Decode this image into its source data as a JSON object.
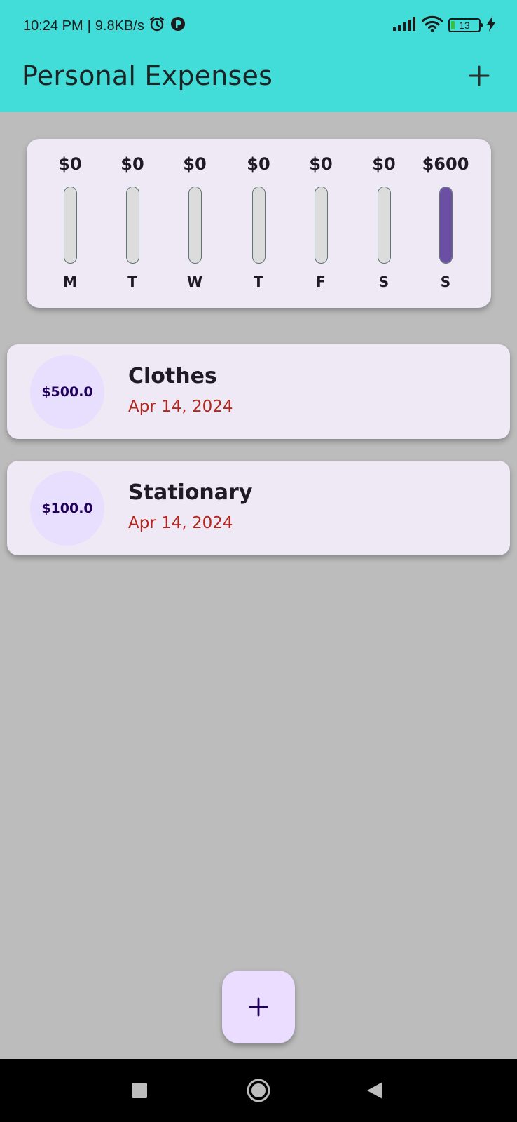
{
  "status_bar": {
    "time": "10:24 PM",
    "separator": "|",
    "net_speed": "9.8KB/s",
    "battery_level": "13",
    "icons": [
      "alarm-icon",
      "app-notification-icon",
      "signal-icon",
      "wifi-icon",
      "battery-icon",
      "charging-icon"
    ]
  },
  "app_bar": {
    "title": "Personal Expenses",
    "action_icon": "plus-icon"
  },
  "chart": {
    "bars": [
      {
        "day": "M",
        "amount": "$0",
        "fill_fraction": 0
      },
      {
        "day": "T",
        "amount": "$0",
        "fill_fraction": 0
      },
      {
        "day": "W",
        "amount": "$0",
        "fill_fraction": 0
      },
      {
        "day": "T",
        "amount": "$0",
        "fill_fraction": 0
      },
      {
        "day": "F",
        "amount": "$0",
        "fill_fraction": 0
      },
      {
        "day": "S",
        "amount": "$0",
        "fill_fraction": 0
      },
      {
        "day": "S",
        "amount": "$600",
        "fill_fraction": 1
      }
    ]
  },
  "expenses": [
    {
      "amount": "$500.0",
      "title": "Clothes",
      "date": "Apr 14, 2024"
    },
    {
      "amount": "$100.0",
      "title": "Stationary",
      "date": "Apr 14, 2024"
    }
  ],
  "fab": {
    "icon": "plus-icon"
  },
  "nav_bar": {
    "icons": [
      "recent-apps-icon",
      "home-icon",
      "back-icon"
    ]
  },
  "colors": {
    "app_bar": "#42dcd9",
    "background": "#bcbcbc",
    "card": "#efe9f5",
    "bar_fill": "#6a4fa3",
    "date_text": "#b3261e",
    "circle": "#e8defe",
    "fab": "#eaddff"
  }
}
